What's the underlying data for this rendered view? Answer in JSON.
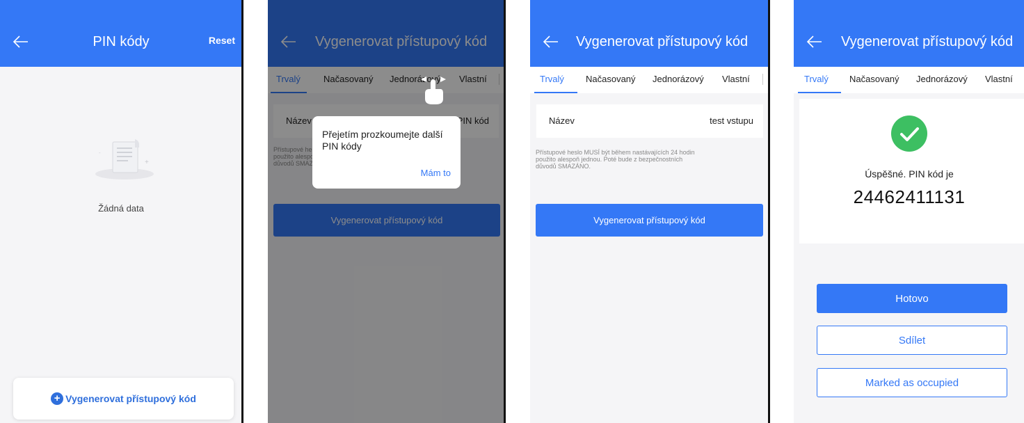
{
  "screen1": {
    "title": "PIN kódy",
    "reset": "Reset",
    "empty_text": "Žádná data",
    "generate_button": "Vygenerovat přístupový kód"
  },
  "generate": {
    "title": "Vygenerovat přístupový kód",
    "tabs": [
      "Trvalý",
      "Načasovaný",
      "Jednorázový",
      "Vlastní"
    ],
    "name_label": "Název",
    "pin_label": "PIN kód",
    "note_lines": [
      "Přístupové heslo MUSÍ být během nastávajících 24 hodin",
      "použito alespoň jednou. Poté bude z bezpečnostních",
      "důvodů SMAZÁNO."
    ],
    "generate_button": "Vygenerovat přístupový kód"
  },
  "dialog": {
    "message": "Přejetím prozkoumejte další PIN kódy",
    "confirm": "Mám to"
  },
  "screen3": {
    "name_value": "test vstupu"
  },
  "result": {
    "success_text": "Úspěšné. PIN kód je",
    "pin": "24462411131",
    "done": "Hotovo",
    "share": "Sdílet",
    "occupied": "Marked as occupied"
  },
  "colors": {
    "accent": "#3478f6",
    "success": "#3dbf62"
  }
}
